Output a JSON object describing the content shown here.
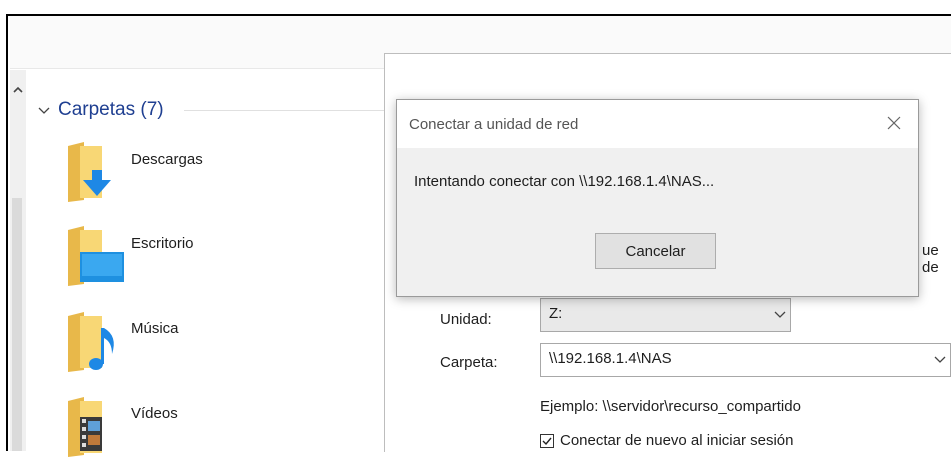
{
  "explorer": {
    "group_title": "Carpetas (7)",
    "folders": [
      {
        "label": "Descargas",
        "icon": "downloads-folder-icon"
      },
      {
        "label": "Escritorio",
        "icon": "desktop-folder-icon"
      },
      {
        "label": "Música",
        "icon": "music-folder-icon"
      },
      {
        "label": "Vídeos",
        "icon": "videos-folder-icon"
      }
    ]
  },
  "wizard": {
    "partial_text": "ue de",
    "drive_label": "Unidad:",
    "drive_value": "Z:",
    "folder_label": "Carpeta:",
    "folder_value": "\\\\192.168.1.4\\NAS",
    "example": "Ejemplo: \\\\servidor\\recurso_compartido",
    "reconnect_label": "Conectar de nuevo al iniciar sesión",
    "reconnect_checked": true
  },
  "dialog": {
    "title": "Conectar a unidad de red",
    "message": "Intentando conectar con \\\\192.168.1.4\\NAS...",
    "cancel_label": "Cancelar"
  },
  "colors": {
    "folder_yellow": "#f8d775",
    "accent_blue": "#1e90e0",
    "group_title": "#1f3f91"
  }
}
